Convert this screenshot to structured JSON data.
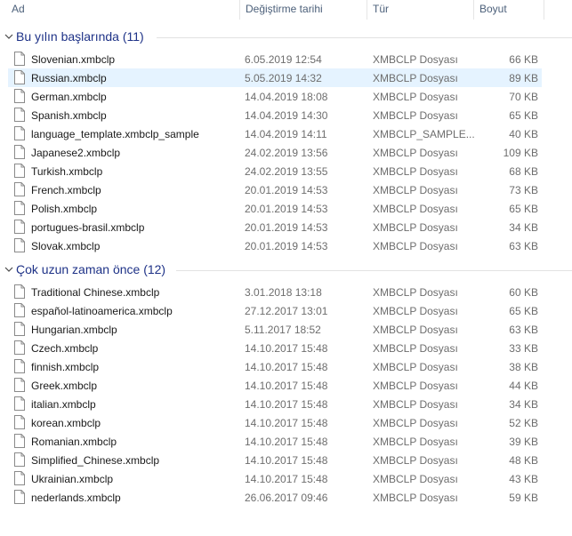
{
  "columns": {
    "name": "Ad",
    "date": "Değiştirme tarihi",
    "type": "Tür",
    "size": "Boyut"
  },
  "groups": [
    {
      "title": "Bu yılın başlarında (11)",
      "items": [
        {
          "name": "Slovenian.xmbclp",
          "date": "6.05.2019 12:54",
          "type": "XMBCLP Dosyası",
          "size": "66 KB"
        },
        {
          "name": "Russian.xmbclp",
          "date": "5.05.2019 14:32",
          "type": "XMBCLP Dosyası",
          "size": "89 KB",
          "selected": true
        },
        {
          "name": "German.xmbclp",
          "date": "14.04.2019 18:08",
          "type": "XMBCLP Dosyası",
          "size": "70 KB"
        },
        {
          "name": "Spanish.xmbclp",
          "date": "14.04.2019 14:30",
          "type": "XMBCLP Dosyası",
          "size": "65 KB"
        },
        {
          "name": "language_template.xmbclp_sample",
          "date": "14.04.2019 14:11",
          "type": "XMBCLP_SAMPLE...",
          "size": "40 KB"
        },
        {
          "name": "Japanese2.xmbclp",
          "date": "24.02.2019 13:56",
          "type": "XMBCLP Dosyası",
          "size": "109 KB"
        },
        {
          "name": "Turkish.xmbclp",
          "date": "24.02.2019 13:55",
          "type": "XMBCLP Dosyası",
          "size": "68 KB"
        },
        {
          "name": "French.xmbclp",
          "date": "20.01.2019 14:53",
          "type": "XMBCLP Dosyası",
          "size": "73 KB"
        },
        {
          "name": "Polish.xmbclp",
          "date": "20.01.2019 14:53",
          "type": "XMBCLP Dosyası",
          "size": "65 KB"
        },
        {
          "name": "portugues-brasil.xmbclp",
          "date": "20.01.2019 14:53",
          "type": "XMBCLP Dosyası",
          "size": "34 KB"
        },
        {
          "name": "Slovak.xmbclp",
          "date": "20.01.2019 14:53",
          "type": "XMBCLP Dosyası",
          "size": "63 KB"
        }
      ]
    },
    {
      "title": "Çok uzun zaman önce (12)",
      "items": [
        {
          "name": "Traditional Chinese.xmbclp",
          "date": "3.01.2018 13:18",
          "type": "XMBCLP Dosyası",
          "size": "60 KB"
        },
        {
          "name": "español-latinoamerica.xmbclp",
          "date": "27.12.2017 13:01",
          "type": "XMBCLP Dosyası",
          "size": "65 KB"
        },
        {
          "name": "Hungarian.xmbclp",
          "date": "5.11.2017 18:52",
          "type": "XMBCLP Dosyası",
          "size": "63 KB"
        },
        {
          "name": "Czech.xmbclp",
          "date": "14.10.2017 15:48",
          "type": "XMBCLP Dosyası",
          "size": "33 KB"
        },
        {
          "name": "finnish.xmbclp",
          "date": "14.10.2017 15:48",
          "type": "XMBCLP Dosyası",
          "size": "38 KB"
        },
        {
          "name": "Greek.xmbclp",
          "date": "14.10.2017 15:48",
          "type": "XMBCLP Dosyası",
          "size": "44 KB"
        },
        {
          "name": "italian.xmbclp",
          "date": "14.10.2017 15:48",
          "type": "XMBCLP Dosyası",
          "size": "34 KB"
        },
        {
          "name": "korean.xmbclp",
          "date": "14.10.2017 15:48",
          "type": "XMBCLP Dosyası",
          "size": "52 KB"
        },
        {
          "name": "Romanian.xmbclp",
          "date": "14.10.2017 15:48",
          "type": "XMBCLP Dosyası",
          "size": "39 KB"
        },
        {
          "name": "Simplified_Chinese.xmbclp",
          "date": "14.10.2017 15:48",
          "type": "XMBCLP Dosyası",
          "size": "48 KB"
        },
        {
          "name": "Ukrainian.xmbclp",
          "date": "14.10.2017 15:48",
          "type": "XMBCLP Dosyası",
          "size": "43 KB"
        },
        {
          "name": "nederlands.xmbclp",
          "date": "26.06.2017 09:46",
          "type": "XMBCLP Dosyası",
          "size": "59 KB"
        }
      ]
    }
  ],
  "icons": {
    "file": "file-icon",
    "group_toggle": "chevron-down-icon"
  },
  "colors": {
    "group_title": "#1e3287",
    "header_text": "#4c607a",
    "selection": "#e5f3ff"
  }
}
